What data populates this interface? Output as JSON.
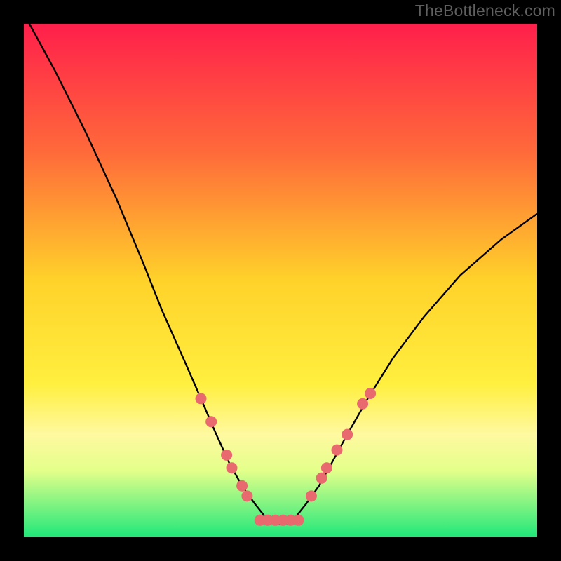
{
  "watermark": "TheBottleneck.com",
  "chart_data": {
    "type": "line",
    "title": "",
    "xlabel": "",
    "ylabel": "",
    "xlim": [
      0,
      100
    ],
    "ylim": [
      0,
      100
    ],
    "background_gradient": {
      "stops": [
        {
          "offset": 0,
          "color": "#ff1f4b"
        },
        {
          "offset": 25,
          "color": "#ff6a3a"
        },
        {
          "offset": 50,
          "color": "#ffd22a"
        },
        {
          "offset": 70,
          "color": "#ffef3e"
        },
        {
          "offset": 80,
          "color": "#fff9a0"
        },
        {
          "offset": 87,
          "color": "#e4ff8a"
        },
        {
          "offset": 100,
          "color": "#1fe87a"
        }
      ]
    },
    "series": [
      {
        "name": "bottleneck-curve",
        "color": "#000000",
        "x": [
          0,
          6,
          12,
          18,
          23,
          27,
          31,
          34.5,
          37.5,
          40,
          42.5,
          45,
          47,
          49,
          51,
          53,
          55,
          57.5,
          60,
          63,
          67,
          72,
          78,
          85,
          93,
          100
        ],
        "y": [
          102,
          91,
          79,
          66,
          54,
          44,
          35,
          27,
          20,
          14.5,
          10,
          6.5,
          4,
          2.5,
          2.5,
          4,
          6.5,
          10,
          14.5,
          20,
          27,
          35,
          43,
          51,
          58,
          63
        ]
      }
    ],
    "markers": {
      "name": "highlight-points",
      "color": "#e86a6f",
      "radius": 8,
      "points": [
        {
          "x": 34.5,
          "y": 27
        },
        {
          "x": 36.5,
          "y": 22.5
        },
        {
          "x": 39.5,
          "y": 16
        },
        {
          "x": 40.5,
          "y": 13.5
        },
        {
          "x": 42.5,
          "y": 10
        },
        {
          "x": 43.5,
          "y": 8
        },
        {
          "x": 46,
          "y": 3.3
        },
        {
          "x": 47.5,
          "y": 3.3
        },
        {
          "x": 49,
          "y": 3.3
        },
        {
          "x": 50.5,
          "y": 3.3
        },
        {
          "x": 52,
          "y": 3.3
        },
        {
          "x": 53.5,
          "y": 3.3
        },
        {
          "x": 56,
          "y": 8
        },
        {
          "x": 58,
          "y": 11.5
        },
        {
          "x": 59,
          "y": 13.5
        },
        {
          "x": 61,
          "y": 17
        },
        {
          "x": 63,
          "y": 20
        },
        {
          "x": 66,
          "y": 26
        },
        {
          "x": 67.5,
          "y": 28
        }
      ]
    }
  }
}
